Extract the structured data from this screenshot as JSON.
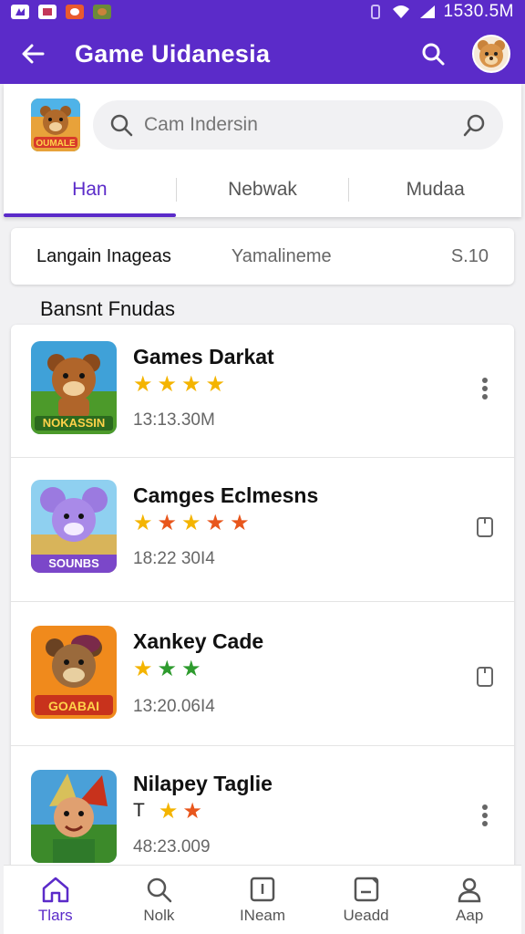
{
  "status_bar": {
    "time": "1530.5M"
  },
  "app_bar": {
    "title": "Game Uidanesia"
  },
  "search": {
    "placeholder": "Cam Indersin"
  },
  "logo": {
    "text": "OUMALE"
  },
  "tabs": [
    {
      "label": "Han",
      "active": true
    },
    {
      "label": "Nebwak",
      "active": false
    },
    {
      "label": "Mudaa",
      "active": false
    }
  ],
  "filter_bar": {
    "item1": "Langain Inageas",
    "item2": "Yamalineme",
    "item3": "S.10"
  },
  "section": {
    "title": "Bansnt Fnudas"
  },
  "games": [
    {
      "title": "Games Darkat",
      "time": "13:13.30M",
      "thumb_text": "NOKASSIN",
      "stars": [
        "yellow",
        "yellow",
        "yellow",
        "yellow"
      ],
      "prefix": "",
      "action": "more-icon"
    },
    {
      "title": "Camges Eclmesns",
      "time": "18:22 30I4",
      "thumb_text": "SOUNBS",
      "stars": [
        "yellow",
        "orange",
        "yellow",
        "orange",
        "orange"
      ],
      "prefix": "",
      "action": "bookmark-icon"
    },
    {
      "title": "Xankey Cade",
      "time": "13:20.06I4",
      "thumb_text": "GOABAI",
      "stars": [
        "yellow",
        "green",
        "green"
      ],
      "prefix": "",
      "action": "bookmark-icon"
    },
    {
      "title": "Nilapey Taglie",
      "time": "48:23.009",
      "thumb_text": "",
      "stars": [
        "yellow",
        "orange"
      ],
      "prefix": "T",
      "action": "more-icon"
    }
  ],
  "bottom_nav": [
    {
      "label": "Tlars",
      "icon": "home-icon",
      "active": true
    },
    {
      "label": "Nolk",
      "icon": "search-icon",
      "active": false
    },
    {
      "label": "INeam",
      "icon": "card-icon",
      "active": false
    },
    {
      "label": "Ueadd",
      "icon": "edit-icon",
      "active": false
    },
    {
      "label": "Aap",
      "icon": "profile-icon",
      "active": false
    }
  ],
  "colors": {
    "primary": "#5b2bc9",
    "star_yellow": "#f4b400",
    "star_orange": "#e8561c",
    "star_green": "#2e9b2e"
  }
}
